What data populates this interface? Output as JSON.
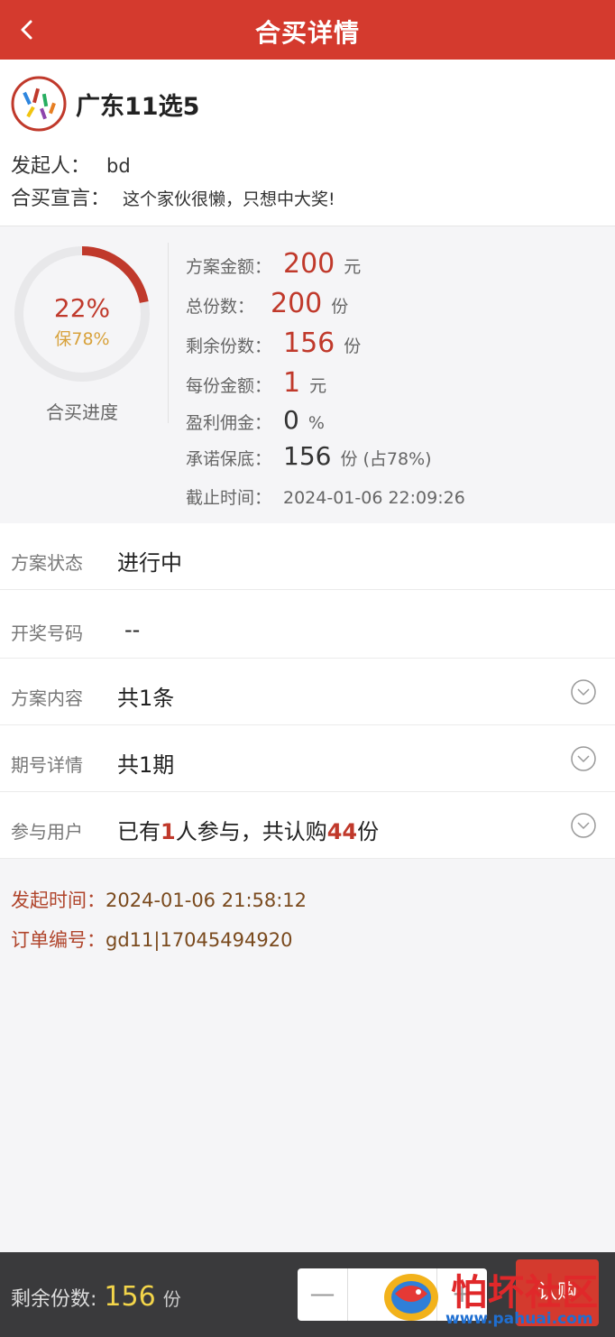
{
  "header": {
    "title": "合买详情"
  },
  "lottery": {
    "name": "广东11选5"
  },
  "initiator": {
    "label": "发起人：",
    "value": "bd"
  },
  "slogan": {
    "label": "合买宣言：",
    "value": "这个家伙很懒，只想中大奖!"
  },
  "progress": {
    "percent": "22%",
    "percent_value": 22,
    "guarantee": "保78%",
    "guarantee_value": 78,
    "label": "合买进度"
  },
  "plan_info": {
    "amount": {
      "label": "方案金额：",
      "value": "200",
      "unit": "元"
    },
    "total_shares": {
      "label": "总份数：",
      "value": "200",
      "unit": "份"
    },
    "remaining": {
      "label": "剩余份数：",
      "value": "156",
      "unit": "份"
    },
    "per_share": {
      "label": "每份金额：",
      "value": "1",
      "unit": "元"
    },
    "commission": {
      "label": "盈利佣金：",
      "value": "0",
      "unit": "%"
    },
    "guarantee": {
      "label": "承诺保底：",
      "value": "156",
      "unit": "份 (占78%)"
    },
    "deadline": {
      "label": "截止时间：",
      "value": "2024-01-06 22:09:26"
    }
  },
  "list": {
    "status": {
      "label": "方案状态",
      "value": "进行中"
    },
    "draw_number": {
      "label": "开奖号码",
      "value": "--"
    },
    "content": {
      "label": "方案内容",
      "value": "共1条"
    },
    "issue": {
      "label": "期号详情",
      "value": "共1期"
    },
    "users": {
      "label": "参与用户",
      "prefix": "已有",
      "count": "1",
      "middle": "人参与，共认购",
      "shares": "44",
      "suffix": "份"
    }
  },
  "meta": {
    "start_time": {
      "label": "发起时间：",
      "value": "2024-01-06 21:58:12"
    },
    "order_no": {
      "label": "订单编号：",
      "value": "gd11|17045494920"
    }
  },
  "bottom": {
    "remaining_label": "剩余份数:",
    "remaining_value": "156",
    "remaining_unit": "份",
    "minus": "—",
    "plus": "+",
    "buy_label": "认购"
  },
  "watermark": {
    "text": "怕坏社区",
    "url": "www.pahuai.com"
  },
  "colors": {
    "brand": "#d43a2e",
    "accent": "#c0392b",
    "guarantee": "#d8a23c",
    "bar": "#3a3a3c"
  }
}
